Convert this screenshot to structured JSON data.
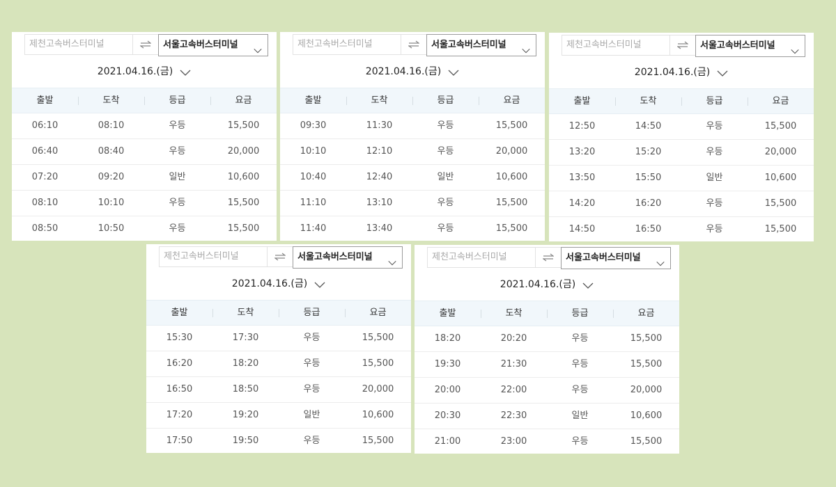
{
  "panels": [
    {
      "origin": "제천고속버스터미널",
      "destination": "서울고속버스터미널",
      "date": "2021.04.16.(금)",
      "headers": [
        "출발",
        "도착",
        "등급",
        "요금"
      ],
      "rows": [
        [
          "06:10",
          "08:10",
          "우등",
          "15,500"
        ],
        [
          "06:40",
          "08:40",
          "우등",
          "20,000"
        ],
        [
          "07:20",
          "09:20",
          "일반",
          "10,600"
        ],
        [
          "08:10",
          "10:10",
          "우등",
          "15,500"
        ],
        [
          "08:50",
          "10:50",
          "우등",
          "15,500"
        ]
      ]
    },
    {
      "origin": "제천고속버스터미널",
      "destination": "서울고속버스터미널",
      "date": "2021.04.16.(금)",
      "headers": [
        "출발",
        "도착",
        "등급",
        "요금"
      ],
      "rows": [
        [
          "09:30",
          "11:30",
          "우등",
          "15,500"
        ],
        [
          "10:10",
          "12:10",
          "우등",
          "20,000"
        ],
        [
          "10:40",
          "12:40",
          "일반",
          "10,600"
        ],
        [
          "11:10",
          "13:10",
          "우등",
          "15,500"
        ],
        [
          "11:40",
          "13:40",
          "우등",
          "15,500"
        ]
      ]
    },
    {
      "origin": "제천고속버스터미널",
      "destination": "서울고속버스터미널",
      "date": "2021.04.16.(금)",
      "headers": [
        "출발",
        "도착",
        "등급",
        "요금"
      ],
      "rows": [
        [
          "12:50",
          "14:50",
          "우등",
          "15,500"
        ],
        [
          "13:20",
          "15:20",
          "우등",
          "20,000"
        ],
        [
          "13:50",
          "15:50",
          "일반",
          "10,600"
        ],
        [
          "14:20",
          "16:20",
          "우등",
          "15,500"
        ],
        [
          "14:50",
          "16:50",
          "우등",
          "15,500"
        ]
      ]
    },
    {
      "origin": "제천고속버스터미널",
      "destination": "서울고속버스터미널",
      "date": "2021.04.16.(금)",
      "headers": [
        "출발",
        "도착",
        "등급",
        "요금"
      ],
      "rows": [
        [
          "15:30",
          "17:30",
          "우등",
          "15,500"
        ],
        [
          "16:20",
          "18:20",
          "우등",
          "15,500"
        ],
        [
          "16:50",
          "18:50",
          "우등",
          "20,000"
        ],
        [
          "17:20",
          "19:20",
          "일반",
          "10,600"
        ],
        [
          "17:50",
          "19:50",
          "우등",
          "15,500"
        ]
      ]
    },
    {
      "origin": "제천고속버스터미널",
      "destination": "서울고속버스터미널",
      "date": "2021.04.16.(금)",
      "headers": [
        "출발",
        "도착",
        "등급",
        "요금"
      ],
      "rows": [
        [
          "18:20",
          "20:20",
          "우등",
          "15,500"
        ],
        [
          "19:30",
          "21:30",
          "우등",
          "15,500"
        ],
        [
          "20:00",
          "22:00",
          "우등",
          "20,000"
        ],
        [
          "20:30",
          "22:30",
          "일반",
          "10,600"
        ],
        [
          "21:00",
          "23:00",
          "우등",
          "15,500"
        ]
      ]
    }
  ],
  "icons": {
    "swap": "swap-arrows-icon",
    "dropdown": "chevron-down-icon"
  },
  "colors": {
    "background": "#d7e4bb",
    "header_row": "#f1f7fb"
  }
}
